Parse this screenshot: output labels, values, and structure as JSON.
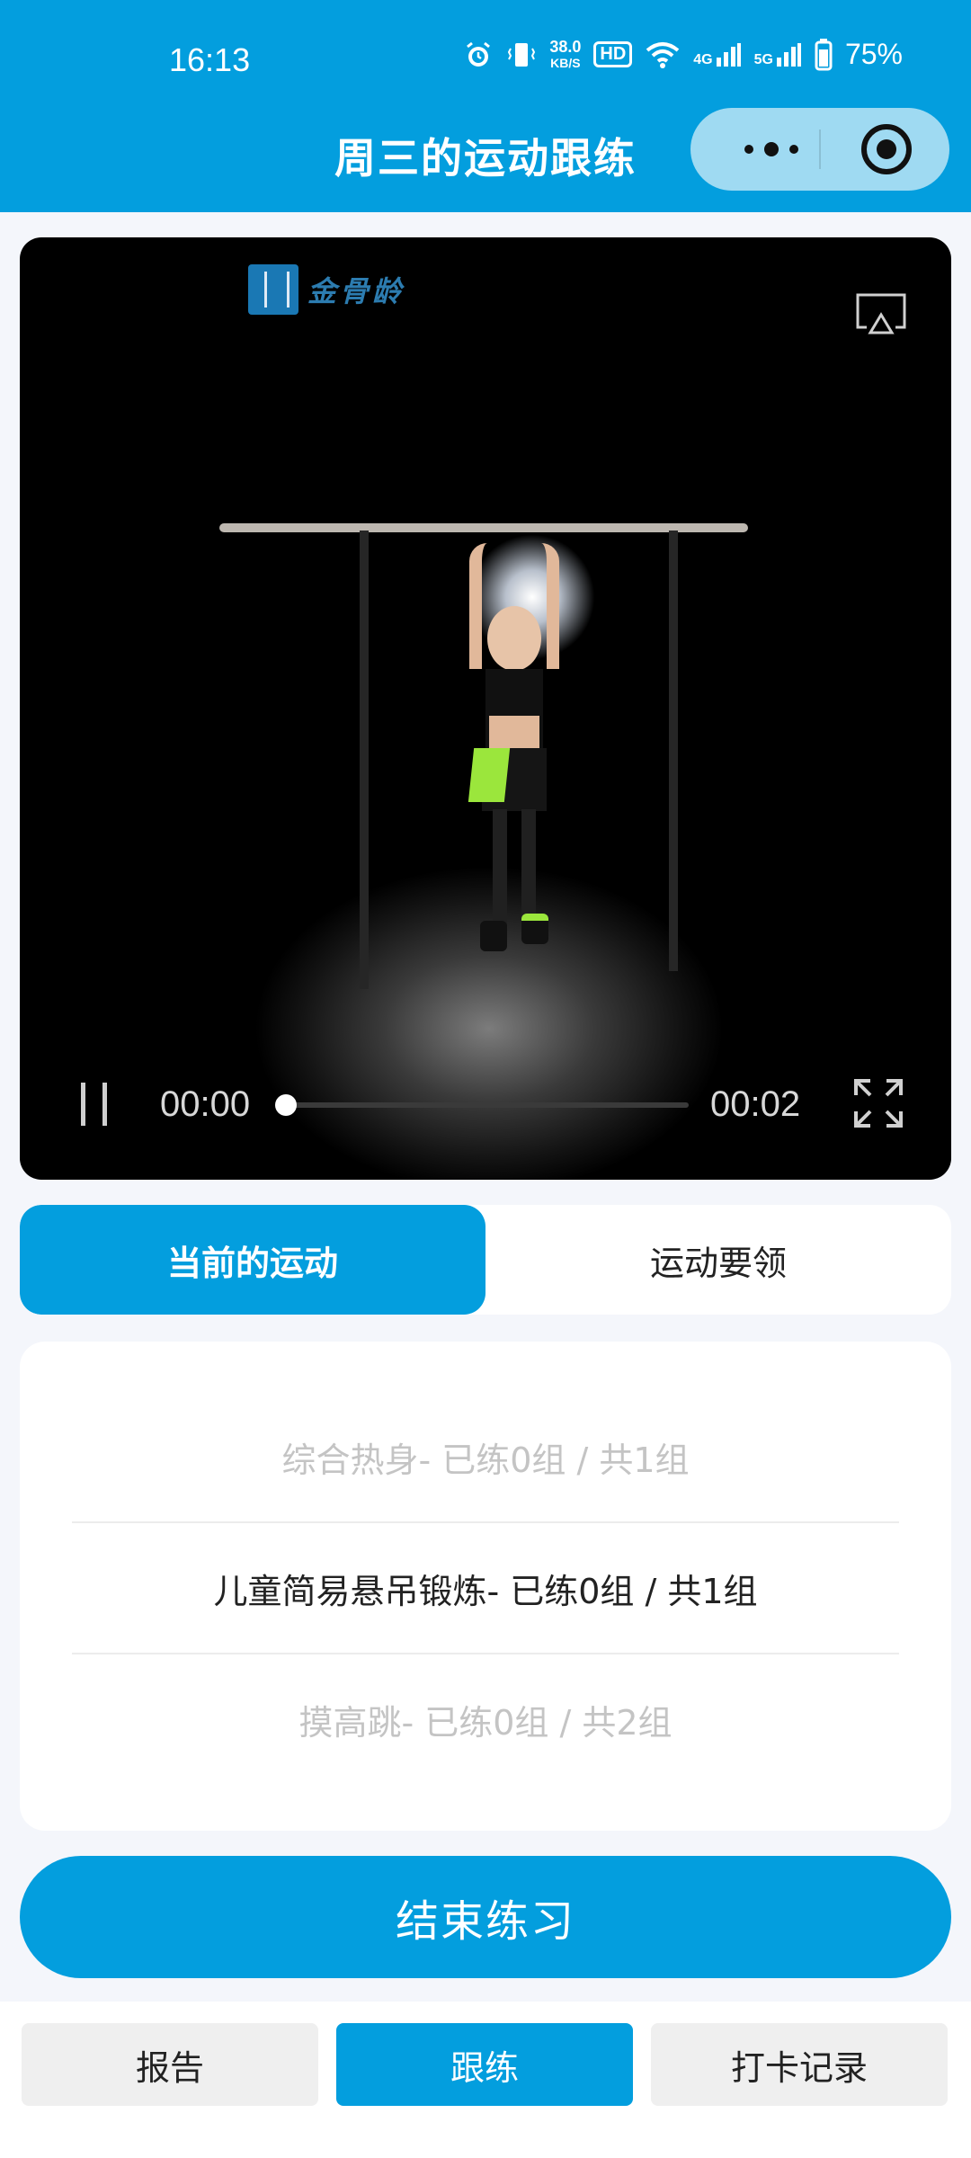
{
  "status_bar": {
    "time": "16:13",
    "net_speed_value": "38.0",
    "net_speed_unit": "KB/S",
    "hd_label": "HD",
    "signal1_label": "4G",
    "signal2_label": "5G",
    "battery": "75%",
    "icons": [
      "alarm-icon",
      "vibrate-icon",
      "wifi-icon",
      "signal-icon",
      "battery-icon"
    ]
  },
  "header": {
    "title": "周三的运动跟练",
    "capsule_icons": [
      "more-icon",
      "close-target-icon"
    ]
  },
  "video": {
    "logo_text": "金骨龄",
    "current_time": "00:00",
    "duration": "00:02",
    "progress": 0.0,
    "icons": [
      "cast-icon",
      "pause-icon",
      "fullscreen-icon"
    ]
  },
  "tabs": [
    {
      "label": "当前的运动",
      "active": true
    },
    {
      "label": "运动要领",
      "active": false
    }
  ],
  "exercises": [
    {
      "text": "综合热身- 已练0组 / 共1组",
      "state": "dim"
    },
    {
      "text": "儿童简易悬吊锻炼- 已练0组 / 共1组",
      "state": "current"
    },
    {
      "text": "摸高跳- 已练0组 / 共2组",
      "state": "dim"
    }
  ],
  "end_button_label": "结束练习",
  "bottom_nav": [
    {
      "label": "报告",
      "active": false
    },
    {
      "label": "跟练",
      "active": true
    },
    {
      "label": "打卡记录",
      "active": false
    }
  ],
  "colors": {
    "primary": "#039ede",
    "background": "#f4f6fb",
    "muted_text": "#c4c4c4"
  }
}
